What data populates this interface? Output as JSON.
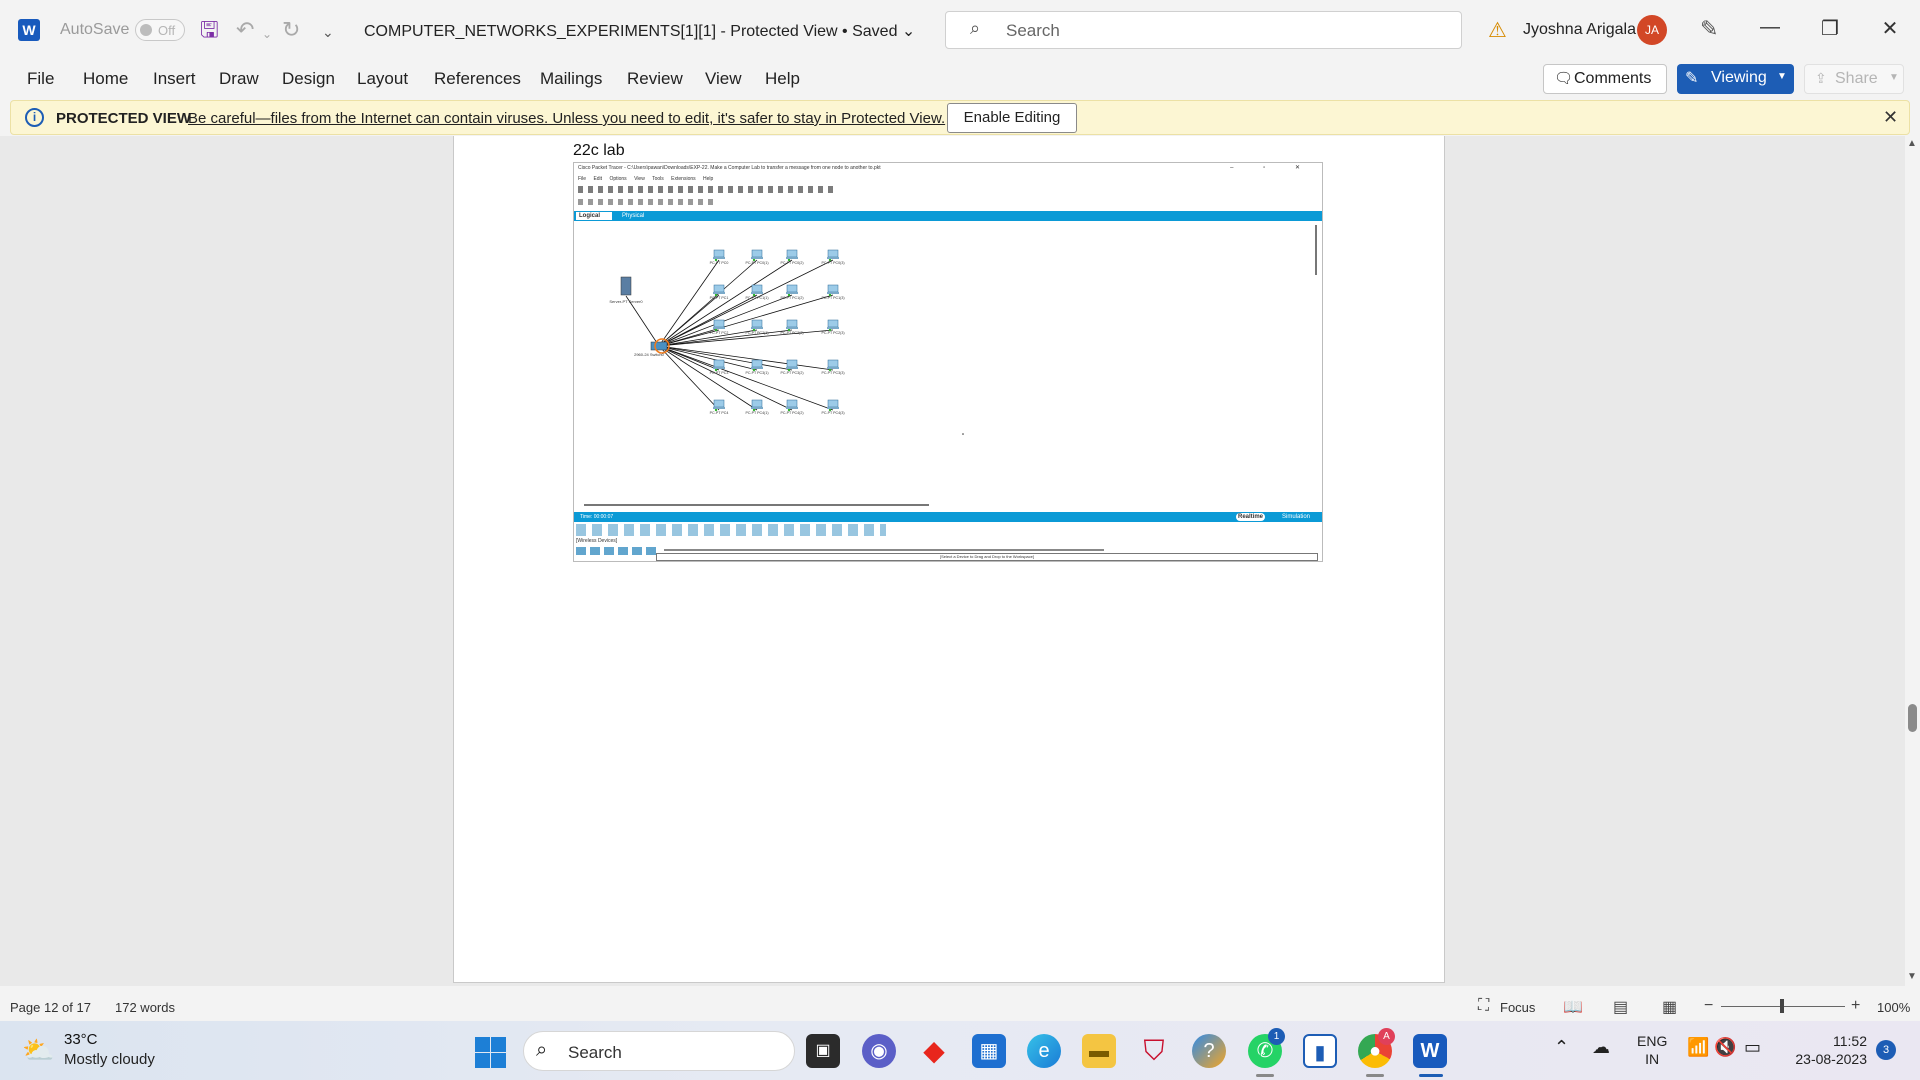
{
  "titlebar": {
    "app_logo": "W",
    "autosave_label": "AutoSave",
    "autosave_state": "Off",
    "doc_title": "COMPUTER_NETWORKS_EXPERIMENTS[1][1]  -  Protected View • Saved ⌄",
    "search_placeholder": "Search",
    "user_name": "Jyoshna Arigala",
    "user_initials": "JA"
  },
  "ribbon": {
    "tabs": [
      "File",
      "Home",
      "Insert",
      "Draw",
      "Design",
      "Layout",
      "References",
      "Mailings",
      "Review",
      "View",
      "Help"
    ],
    "comments_label": "Comments",
    "viewing_label": "Viewing",
    "share_label": "Share"
  },
  "protected_view": {
    "title": "PROTECTED VIEW",
    "message": "Be careful—files from the Internet can contain viruses. Unless you need to edit, it's safer to stay in Protected View.",
    "enable_button": "Enable Editing"
  },
  "document": {
    "caption": "22c lab",
    "embedded_screenshot": {
      "window_title": "Cisco Packet Tracer - C:\\Users\\pawan\\Downloads\\EXP-22. Make a Computer Lab to transfer a message from one node to another to.pkt",
      "menu": "File  Edit  Options  View  Tools  Extensions  Help",
      "tab_logical": "Logical",
      "tab_physical": "Physical",
      "time_label": "Time: 00:00:07",
      "mode_realtime": "Realtime",
      "mode_simulation": "Simulation",
      "wireless_label": "[Wireless Devices]",
      "drag_hint": "[Select a Device to Drag and Drop to the Workspace]",
      "server_label": "Server-PT Server0",
      "switch_label": "2960-24 Switch0",
      "pc_labels": [
        "PC-PT PC0",
        "PC-PT PC0(1)",
        "PC-PT PC0(2)",
        "PC-PT PC0(3)",
        "PC-PT PC1",
        "PC-PT PC1(1)",
        "PC-PT PC1(2)",
        "PC-PT PC1(3)",
        "PC-PT PC2",
        "PC-PT PC2(1)",
        "PC-PT PC2(2)",
        "PC-PT PC2(3)",
        "PC-PT PC3",
        "PC-PT PC3(1)",
        "PC-PT PC3(2)",
        "PC-PT PC3(3)",
        "PC-PT PC4",
        "PC-PT PC4(1)",
        "PC-PT PC4(2)",
        "PC-PT PC4(3)"
      ]
    }
  },
  "statusbar": {
    "page": "Page 12 of 17",
    "words": "172 words",
    "focus": "Focus",
    "zoom": "100%"
  },
  "taskbar": {
    "weather_temp": "33°C",
    "weather_desc": "Mostly cloudy",
    "search_label": "Search",
    "lang_line1": "ENG",
    "lang_line2": "IN",
    "time": "11:52",
    "date": "23-08-2023",
    "notification_count": "3",
    "whatsapp_badge": "1",
    "chrome_badge": "A"
  },
  "colors": {
    "accent": "#1d5db5",
    "word_blue": "#185abd",
    "pv_background": "#fcf6d3",
    "packet_tracer_blue": "#0b9ad6"
  }
}
